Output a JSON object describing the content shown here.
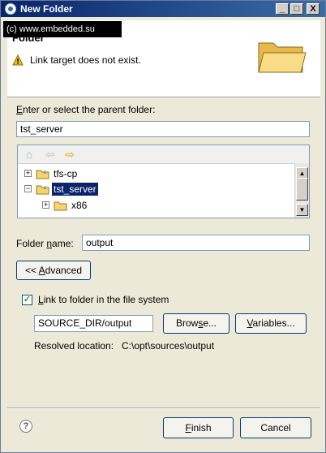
{
  "window": {
    "title": "New Folder",
    "minimize": "_",
    "maximize": "□",
    "close": "X"
  },
  "watermark": "(c) www.embedded.su",
  "banner": {
    "title": "Folder",
    "message": "Link target does not exist."
  },
  "parent": {
    "label_accel": "E",
    "label_rest": "nter or select the parent folder:",
    "value": "tst_server"
  },
  "tree": {
    "nodes": [
      {
        "expander": "+",
        "label": "tfs-cp"
      },
      {
        "expander": "−",
        "label": "tst_server",
        "selected": true
      },
      {
        "expander": "+",
        "label": "x86"
      }
    ]
  },
  "folder_name": {
    "label_pre": "Folder ",
    "label_accel": "n",
    "label_post": "ame:",
    "value": "output"
  },
  "advanced_button": {
    "pre": "<< ",
    "accel": "A",
    "post": "dvanced"
  },
  "link": {
    "checked": true,
    "label_accel": "L",
    "label_rest": "ink to folder in the file system",
    "value": "SOURCE_DIR/output",
    "browse": {
      "pre": "Brow",
      "accel": "s",
      "post": "e..."
    },
    "variables": {
      "accel": "V",
      "post": "ariables..."
    },
    "resolved_label": "Resolved location:",
    "resolved_value": "C:\\opt\\sources\\output"
  },
  "footer": {
    "help": "?",
    "finish": {
      "accel": "F",
      "post": "inish"
    },
    "cancel": "Cancel"
  },
  "colors": {
    "titlebar": "#0a246a",
    "selection": "#0a246a",
    "folder": "#f4d470",
    "warning": "#f2c200"
  }
}
